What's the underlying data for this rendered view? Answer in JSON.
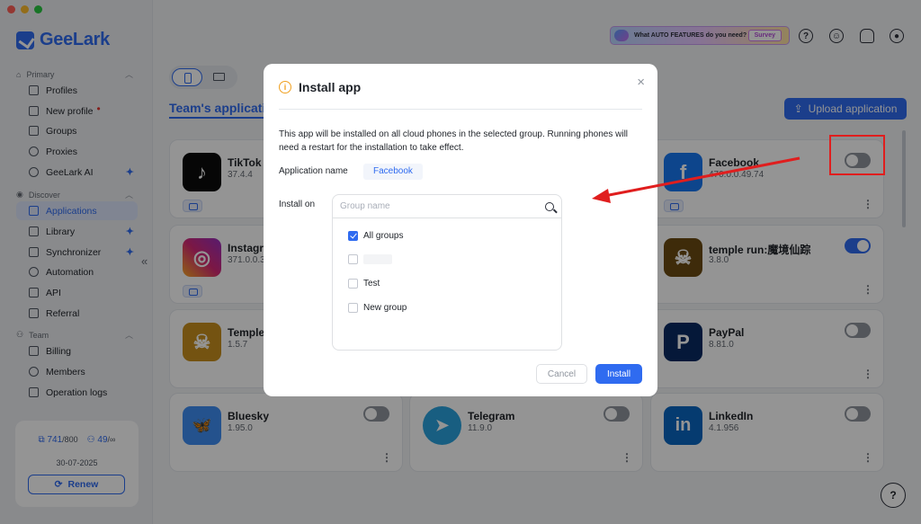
{
  "window": {
    "traffic_colors": [
      "#ff5f57",
      "#febc2e",
      "#28c840"
    ]
  },
  "brand": {
    "name": "GeeLark"
  },
  "sidebar": {
    "sections": [
      {
        "title": "Primary",
        "items": [
          {
            "label": "Profiles",
            "icon": "profiles-icon"
          },
          {
            "label": "New profile",
            "icon": "edit-icon",
            "dot": "•"
          },
          {
            "label": "Groups",
            "icon": "groups-icon"
          },
          {
            "label": "Proxies",
            "icon": "proxies-icon"
          },
          {
            "label": "GeeLark AI",
            "icon": "ai-icon",
            "mark": "✦"
          }
        ]
      },
      {
        "title": "Discover",
        "items": [
          {
            "label": "Applications",
            "icon": "applications-icon",
            "active": true
          },
          {
            "label": "Library",
            "icon": "library-icon",
            "mark": "✦"
          },
          {
            "label": "Synchronizer",
            "icon": "synchronizer-icon",
            "mark": "✦"
          },
          {
            "label": "Automation",
            "icon": "automation-icon"
          },
          {
            "label": "API",
            "icon": "api-icon"
          },
          {
            "label": "Referral",
            "icon": "gift-icon"
          }
        ]
      },
      {
        "title": "Team",
        "items": [
          {
            "label": "Billing",
            "icon": "billing-icon"
          },
          {
            "label": "Members",
            "icon": "members-icon"
          },
          {
            "label": "Operation logs",
            "icon": "logs-icon"
          }
        ]
      }
    ],
    "usage": {
      "profiles_used": "741",
      "profiles_total": "/800",
      "members_used": "49",
      "members_total": "/∞",
      "date": "30-07-2025",
      "renew_label": "Renew"
    }
  },
  "header": {
    "survey_text": "What AUTO FEATURES do you need?",
    "survey_button": "Survey",
    "icons": [
      "help-icon",
      "assistant-icon",
      "bell-icon",
      "account-icon"
    ]
  },
  "main": {
    "tab_title": "Team's applications",
    "upload_label": "Upload application",
    "apps": [
      {
        "name": "TikTok (",
        "version": "37.4.4",
        "color": "#0b0b0b",
        "glyph": "♪",
        "robot": true,
        "toggle": false
      },
      {
        "name": "Facebook",
        "version": "470.0.0.49.74",
        "color": "#1877f2",
        "glyph": "f",
        "robot": true,
        "toggle": false
      },
      {
        "name": "Instagra",
        "version": "371.0.0.3",
        "color": "#d62976",
        "glyph": "◎",
        "robot": true,
        "toggle": false
      },
      {
        "name": "temple run:魔境仙踪",
        "version": "3.8.0",
        "color": "#6b4a12",
        "glyph": "☠",
        "robot": false,
        "toggle": true
      },
      {
        "name": "Temple",
        "version": "1.5.7",
        "color": "#c8901e",
        "glyph": "☠",
        "robot": false,
        "toggle": false
      },
      {
        "name": "PayPal",
        "version": "8.81.0",
        "color": "#0a2a63",
        "glyph": "P",
        "robot": false,
        "toggle": false
      },
      {
        "name": "Bluesky",
        "version": "1.95.0",
        "color": "#3e8df3",
        "glyph": "🦋",
        "robot": false,
        "toggle": false
      },
      {
        "name": "Telegram",
        "version": "11.9.0",
        "color": "#2aa3de",
        "glyph": "➤",
        "robot": false,
        "toggle": false
      },
      {
        "name": "LinkedIn",
        "version": "4.1.956",
        "color": "#0a66c2",
        "glyph": "in",
        "robot": false,
        "toggle": false
      }
    ]
  },
  "modal": {
    "title": "Install app",
    "close": "×",
    "description": "This app will be installed on all cloud phones in the selected group. Running phones will need a restart for the installation to take effect.",
    "app_name_label": "Application name",
    "app_name_value": "Facebook",
    "install_on_label": "Install on",
    "search_placeholder": "Group name",
    "groups": [
      {
        "label": "All groups",
        "checked": true
      },
      {
        "label": "",
        "checked": false
      },
      {
        "label": "Test",
        "checked": false
      },
      {
        "label": "New group",
        "checked": false
      }
    ],
    "cancel_label": "Cancel",
    "install_label": "Install"
  },
  "annotation": {
    "color": "#e01e1e"
  }
}
